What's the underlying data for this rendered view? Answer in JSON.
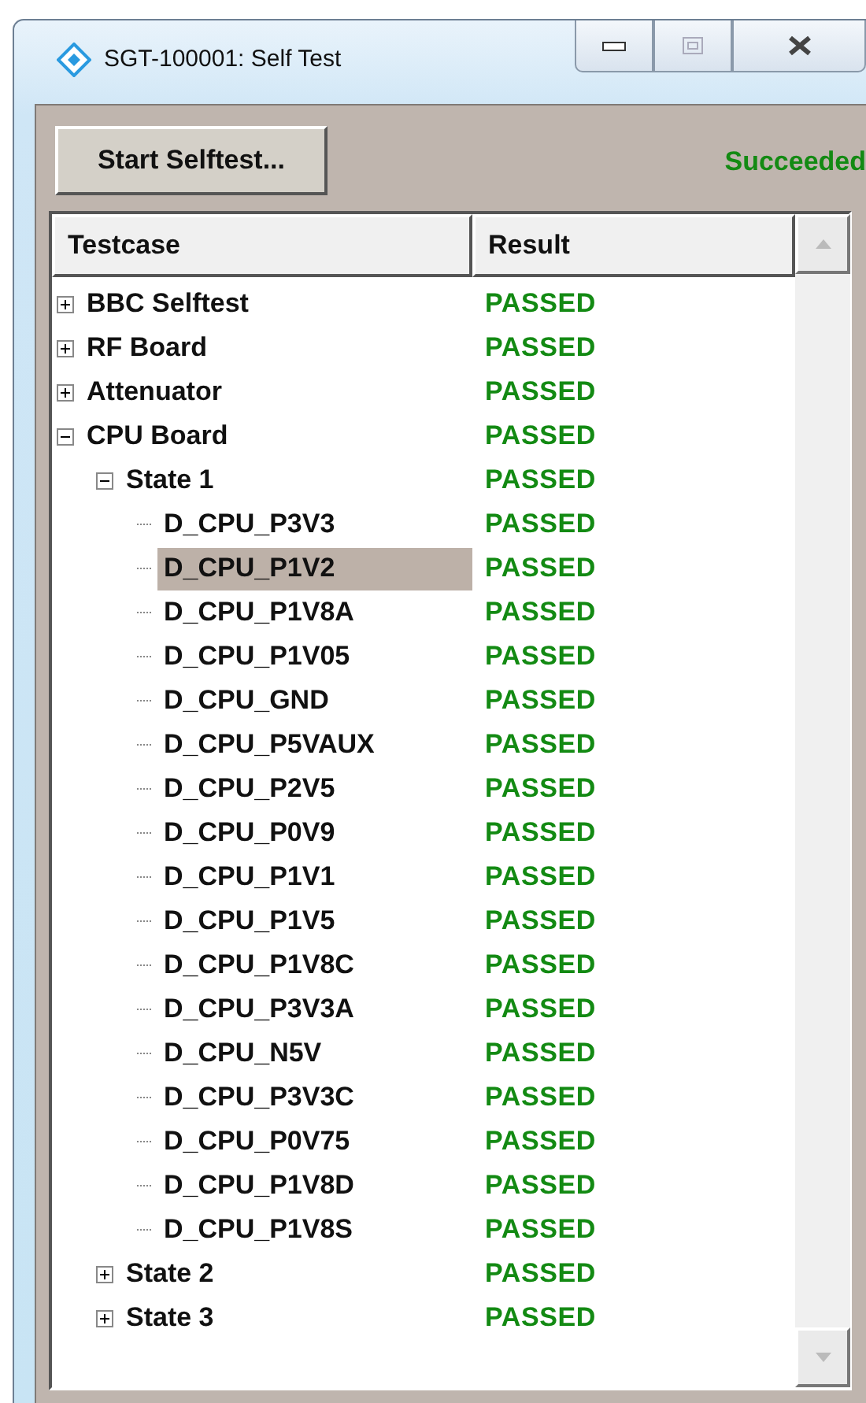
{
  "window": {
    "title": "SGT-100001: Self Test",
    "maximize_disabled": true
  },
  "toolbar": {
    "button": "Start Selftest...",
    "status": "Succeeded"
  },
  "tree": {
    "columns": [
      "Testcase",
      "Result"
    ],
    "rows": [
      {
        "name": "BBC Selftest",
        "result": "PASSED",
        "expanded": false,
        "selected": false
      },
      {
        "name": "RF Board",
        "result": "PASSED",
        "expanded": false,
        "selected": false
      },
      {
        "name": "Attenuator",
        "result": "PASSED",
        "expanded": false,
        "selected": false
      },
      {
        "name": "CPU Board",
        "result": "PASSED",
        "expanded": true,
        "selected": false,
        "children": [
          {
            "name": "State 1",
            "result": "PASSED",
            "expanded": true,
            "selected": false,
            "children": [
              {
                "name": "D_CPU_P3V3",
                "result": "PASSED",
                "selected": false
              },
              {
                "name": "D_CPU_P1V2",
                "result": "PASSED",
                "selected": true
              },
              {
                "name": "D_CPU_P1V8A",
                "result": "PASSED",
                "selected": false
              },
              {
                "name": "D_CPU_P1V05",
                "result": "PASSED",
                "selected": false
              },
              {
                "name": "D_CPU_GND",
                "result": "PASSED",
                "selected": false
              },
              {
                "name": "D_CPU_P5VAUX",
                "result": "PASSED",
                "selected": false
              },
              {
                "name": "D_CPU_P2V5",
                "result": "PASSED",
                "selected": false
              },
              {
                "name": "D_CPU_P0V9",
                "result": "PASSED",
                "selected": false
              },
              {
                "name": "D_CPU_P1V1",
                "result": "PASSED",
                "selected": false
              },
              {
                "name": "D_CPU_P1V5",
                "result": "PASSED",
                "selected": false
              },
              {
                "name": "D_CPU_P1V8C",
                "result": "PASSED",
                "selected": false
              },
              {
                "name": "D_CPU_P3V3A",
                "result": "PASSED",
                "selected": false
              },
              {
                "name": "D_CPU_N5V",
                "result": "PASSED",
                "selected": false
              },
              {
                "name": "D_CPU_P3V3C",
                "result": "PASSED",
                "selected": false
              },
              {
                "name": "D_CPU_P0V75",
                "result": "PASSED",
                "selected": false
              },
              {
                "name": "D_CPU_P1V8D",
                "result": "PASSED",
                "selected": false
              },
              {
                "name": "D_CPU_P1V8S",
                "result": "PASSED",
                "selected": false
              }
            ]
          },
          {
            "name": "State 2",
            "result": "PASSED",
            "expanded": false,
            "selected": false
          },
          {
            "name": "State 3",
            "result": "PASSED",
            "expanded": false,
            "selected": false
          }
        ]
      }
    ]
  }
}
